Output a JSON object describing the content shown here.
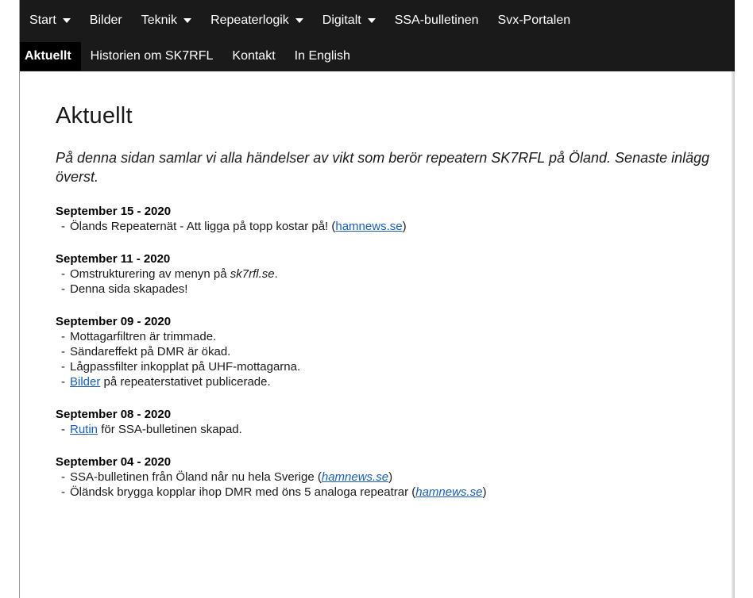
{
  "nav": {
    "row1": [
      {
        "label": "Start",
        "dropdown": true
      },
      {
        "label": "Bilder",
        "dropdown": false
      },
      {
        "label": "Teknik",
        "dropdown": true
      },
      {
        "label": "Repeaterlogik",
        "dropdown": true
      },
      {
        "label": "Digitalt",
        "dropdown": true
      },
      {
        "label": "SSA-bulletinen",
        "dropdown": false
      },
      {
        "label": "Svx-Portalen",
        "dropdown": false
      }
    ],
    "row2": [
      {
        "label": "Aktuellt",
        "active": true
      },
      {
        "label": "Historien om SK7RFL",
        "active": false
      },
      {
        "label": "Kontakt",
        "active": false
      },
      {
        "label": "In English",
        "active": false
      }
    ]
  },
  "page": {
    "title": "Aktuellt",
    "intro": "På denna sidan samlar vi alla händelser av vikt som berör repeatern SK7RFL på Öland. Senaste inlägg överst."
  },
  "entries": [
    {
      "date": "September 15 - 2020",
      "items": [
        {
          "parts": [
            {
              "t": "Ölands Repeaternät - Att ligga på topp kostar på! ("
            },
            {
              "t": "hamnews.se",
              "link": true
            },
            {
              "t": ")"
            }
          ]
        }
      ]
    },
    {
      "date": "September 11 - 2020",
      "items": [
        {
          "parts": [
            {
              "t": "Omstrukturering av menyn på "
            },
            {
              "t": "sk7rfl.se",
              "em": true
            },
            {
              "t": "."
            }
          ]
        },
        {
          "parts": [
            {
              "t": "Denna sida skapades!"
            }
          ]
        }
      ]
    },
    {
      "date": "September 09 - 2020",
      "items": [
        {
          "parts": [
            {
              "t": "Mottagarfiltren är trimmade."
            }
          ]
        },
        {
          "parts": [
            {
              "t": "Sändareffekt på DMR är ökad."
            }
          ]
        },
        {
          "parts": [
            {
              "t": "Lågpassfilter inkopplat på UHF-mottagarna."
            }
          ]
        },
        {
          "parts": [
            {
              "t": "Bilder",
              "link": true
            },
            {
              "t": " på repeaterstativet publicerade."
            }
          ]
        }
      ]
    },
    {
      "date": "September 08 - 2020",
      "items": [
        {
          "parts": [
            {
              "t": "Rutin",
              "link": true
            },
            {
              "t": " för SSA-bulletinen skapad."
            }
          ]
        }
      ]
    },
    {
      "date": "September 04 - 2020",
      "items": [
        {
          "parts": [
            {
              "t": "SSA-bulletinen från Öland når nu hela Sverige ("
            },
            {
              "t": "hamnews.se",
              "link": true,
              "em": true
            },
            {
              "t": ")"
            }
          ]
        },
        {
          "parts": [
            {
              "t": "Öländsk brygga kopplar ihop DMR med öns 5 analoga repeatrar ("
            },
            {
              "t": "hamnews.se",
              "link": true,
              "em": true
            },
            {
              "t": ")"
            }
          ]
        }
      ]
    }
  ],
  "colors": {
    "nav_bg": "#1a1a1a",
    "nav_active_bg": "#000000",
    "link": "#1a5fb4",
    "text": "#1a1a1a"
  }
}
